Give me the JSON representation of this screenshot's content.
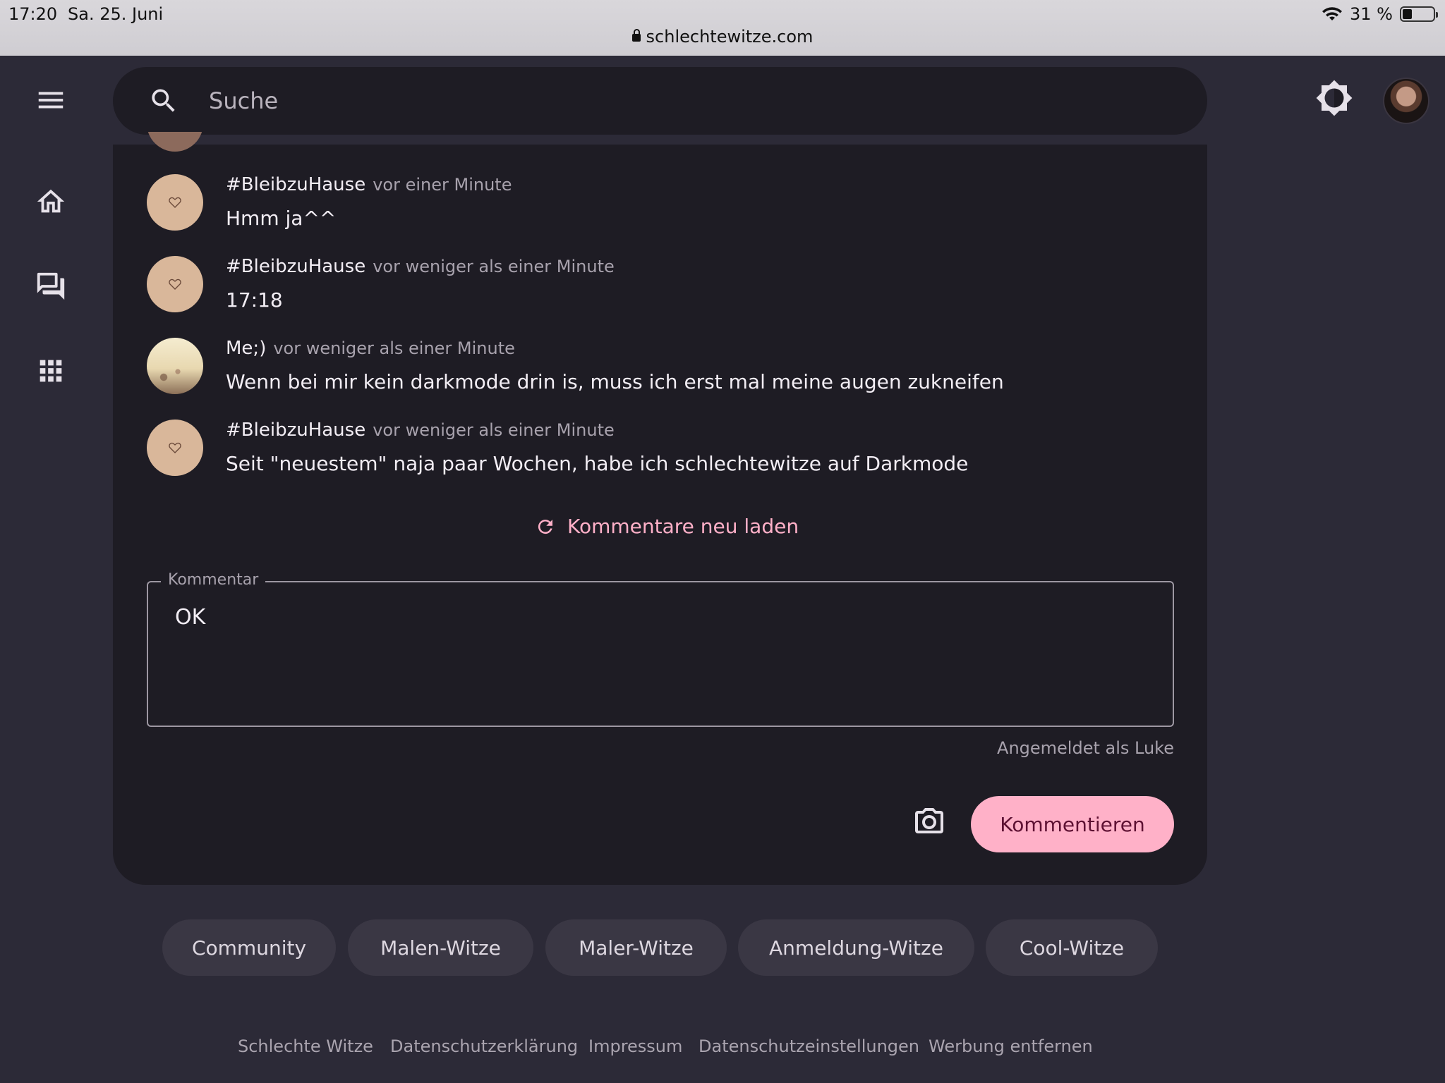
{
  "status_bar": {
    "time": "17:20",
    "date": "Sa. 25. Juni",
    "battery": "31 %",
    "battery_level": 0.31,
    "url": "schlechtewitze.com"
  },
  "header": {
    "search_placeholder": "Suche"
  },
  "comments": [
    {
      "author": "#BleibzuHause",
      "time": "vor einer Minute",
      "text": "Hmm ja^^",
      "avatar": "heart-avatar"
    },
    {
      "author": "#BleibzuHause",
      "time": "vor weniger als einer Minute",
      "text": "17:18",
      "avatar": "heart-avatar"
    },
    {
      "author": "Me;)",
      "time": "vor weniger als einer Minute",
      "text": "Wenn bei mir kein darkmode drin is, muss ich erst mal meine augen zukneifen",
      "avatar": "photo-avatar"
    },
    {
      "author": "#BleibzuHause",
      "time": "vor weniger als einer Minute",
      "text": "Seit \"neuestem\" naja paar Wochen, habe ich schlechtewitze auf Darkmode",
      "avatar": "heart-avatar"
    }
  ],
  "reload_label": "Kommentare neu laden",
  "comment_form": {
    "label": "Kommentar",
    "value": "OK",
    "logged_in_as": "Angemeldet als Luke",
    "submit_label": "Kommentieren"
  },
  "tags": [
    "Community",
    "Malen-Witze",
    "Maler-Witze",
    "Anmeldung-Witze",
    "Cool-Witze"
  ],
  "footer": [
    "Schlechte Witze",
    "Datenschutzerklärung",
    "Impressum",
    "Datenschutzeinstellungen",
    "Werbung entfernen"
  ],
  "colors": {
    "background": "#2c2a37",
    "surface": "#1e1c24",
    "accent": "#ffb1c8",
    "chip": "#3a3744"
  },
  "icons": [
    "menu-icon",
    "search-icon",
    "brightness-icon",
    "home-icon",
    "forum-icon",
    "apps-icon",
    "refresh-icon",
    "camera-icon",
    "lock-icon",
    "wifi-icon",
    "battery-icon"
  ]
}
